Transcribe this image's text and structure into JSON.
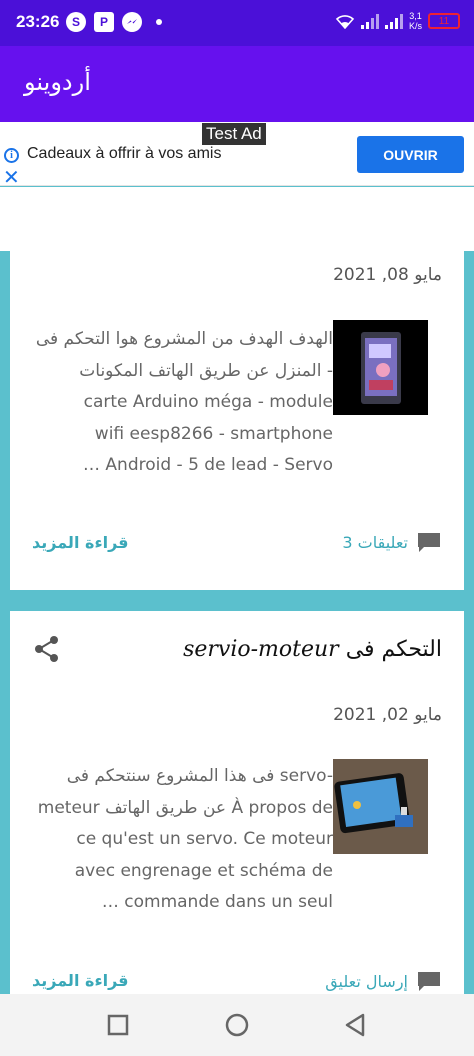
{
  "status_bar": {
    "time": "23:26",
    "net_speed_value": "3,1",
    "net_speed_unit": "K/s",
    "battery": "11"
  },
  "app_bar": {
    "title": "أردوينو"
  },
  "ad": {
    "tag": "Test Ad",
    "text": "Cadeaux à offrir à vos amis",
    "button": "OUVRIR"
  },
  "posts": [
    {
      "date": "مايو 08, 2021",
      "lines": [
        "الهدف الهدف من المشروع هوا التحكم فى",
        "المنزل عن طريق الهاتف المكونات   -",
        "carte Arduino méga      - module",
        "wifi eesp8266      - smartphone",
        "…   Android    -  5 de lead    - Servo"
      ],
      "read_more": "قراءة المزيد",
      "comments": "3 تعليقات"
    },
    {
      "title_arabic": "التحكم فى",
      "title_latin": "servio-moteur",
      "date": "مايو 02, 2021",
      "lines": [
        "فى هذا المشروع سنتحكم فى servo-",
        "meteur عن طريق الهاتف À propos de",
        "ce qu'est un servo. Ce moteur",
        "avec engrenage et schéma de",
        "…              commande dans un seul"
      ],
      "read_more": "قراءة المزيد",
      "comments": "إرسال تعليق"
    }
  ],
  "colors": {
    "status_bar": "#4b10d8",
    "app_bar": "#6611ee",
    "accent": "#3aa8b8",
    "background": "#5bc0cd",
    "ad_button": "#1a73e8"
  }
}
